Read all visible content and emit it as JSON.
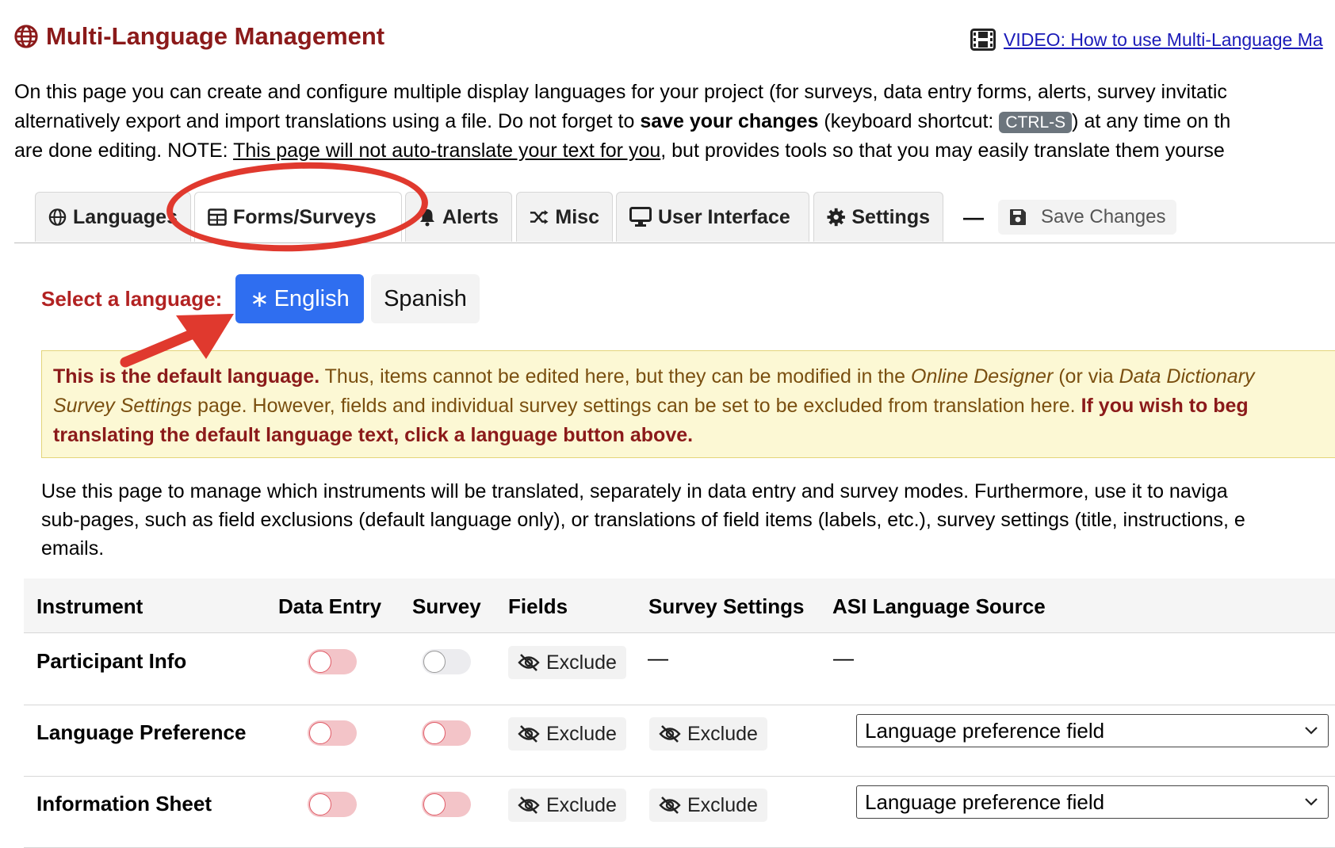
{
  "header": {
    "title": "Multi-Language Management",
    "video_link": "VIDEO: How to use Multi-Language Ma"
  },
  "intro": {
    "line1": "On this page you can create and configure multiple display languages for your project (for surveys, data entry forms, alerts, survey invitatic",
    "line2_a": "alternatively export and import translations using a file. Do not forget to ",
    "line2_bold": "save your changes",
    "line2_b": " (keyboard shortcut: ",
    "shortcut": "CTRL-S",
    "line2_c": ") at any time on th",
    "line3_a": "are done editing. NOTE: ",
    "line3_u": "This page will not auto-translate your text for you",
    "line3_b": ", but provides tools so that you may easily translate them yourse"
  },
  "tabs": [
    {
      "label": "Languages",
      "icon": "globe-icon"
    },
    {
      "label": "Forms/Surveys",
      "icon": "table-icon"
    },
    {
      "label": "Alerts",
      "icon": "bell-icon"
    },
    {
      "label": "Misc",
      "icon": "shuffle-icon"
    },
    {
      "label": "User Interface",
      "icon": "monitor-icon"
    },
    {
      "label": "Settings",
      "icon": "gear-icon"
    }
  ],
  "toolbar": {
    "separator": "—",
    "save_label": "Save Changes"
  },
  "language_select": {
    "label": "Select a language:",
    "english": "English",
    "spanish": "Spanish"
  },
  "warning": {
    "b1": "This is the default language.",
    "t1": " Thus, items cannot be edited here, but they can be modified in the ",
    "i1": "Online Designer",
    "t2": " (or via ",
    "i2": "Data Dictionary",
    "i3": "Survey Settings",
    "t3": " page. However, fields and individual survey settings can be set to be excluded from translation here. ",
    "b2": "If you wish to beg",
    "b3": "translating the default language text, click a language button above."
  },
  "usage": {
    "line1": "Use this page to manage which instruments will be translated, separately in data entry and survey modes. Furthermore, use it to naviga",
    "line2": "sub-pages, such as field exclusions (default language only), or translations of field items (labels, etc.), survey settings (title, instructions, e",
    "line3": "emails."
  },
  "table": {
    "headers": {
      "instrument": "Instrument",
      "data_entry": "Data Entry",
      "survey": "Survey",
      "fields": "Fields",
      "survey_settings": "Survey Settings",
      "asi_source": "ASI Language Source"
    },
    "rows": [
      {
        "name": "Participant Info",
        "data_entry": "off",
        "survey": "off",
        "fields": "Exclude",
        "survey_settings": "—",
        "asi": "—"
      },
      {
        "name": "Language Preference",
        "data_entry": "off",
        "survey": "off",
        "fields": "Exclude",
        "survey_settings": "Exclude",
        "asi": "Language preference field"
      },
      {
        "name": "Information Sheet",
        "data_entry": "off",
        "survey": "off",
        "fields": "Exclude",
        "survey_settings": "Exclude",
        "asi": "Language preference field"
      }
    ]
  },
  "colors": {
    "title": "#8b1a1a",
    "primary_button": "#2f6ef0",
    "annotation": "#e0392e",
    "warning_bg": "#fcf8d4"
  }
}
